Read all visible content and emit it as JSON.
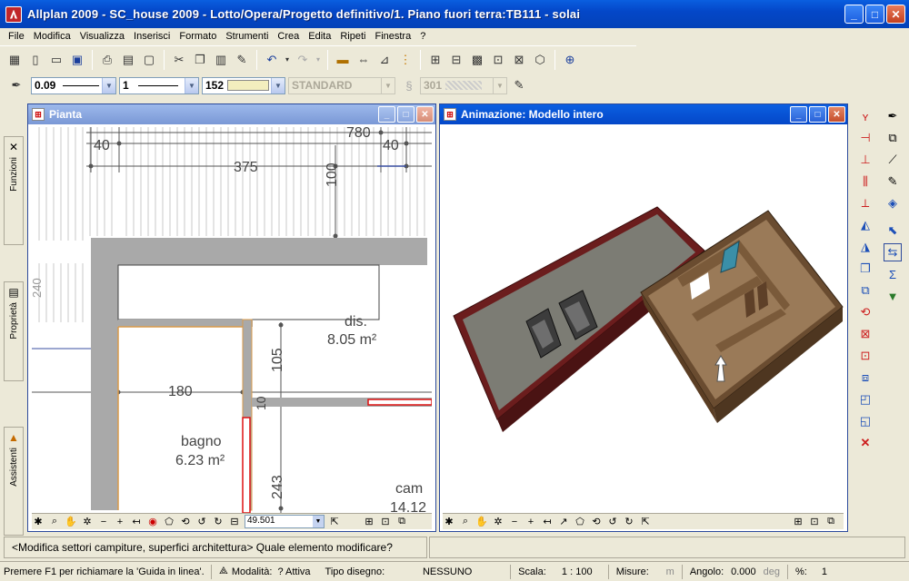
{
  "window": {
    "title": "Allplan 2009 - SC_house 2009 - Lotto/Opera/Progetto definitivo/1. Piano fuori terra:TB111 - solai",
    "min": "_",
    "max": "□",
    "close": "✕"
  },
  "menu": [
    "File",
    "Modifica",
    "Visualizza",
    "Inserisci",
    "Formato",
    "Strumenti",
    "Crea",
    "Edita",
    "Ripeti",
    "Finestra",
    "?"
  ],
  "format_bar": {
    "pen": "0.09",
    "line": "1",
    "color_index": "152",
    "layer": "STANDARD",
    "pattern": "301"
  },
  "left_tabs": [
    "Funzioni",
    "Proprietà",
    "Assistenti"
  ],
  "pianta": {
    "title": "Pianta",
    "dims": {
      "d40a": "40",
      "d780": "780",
      "d40b": "40",
      "d375": "375",
      "d100": "100",
      "d240": "240",
      "d105": "105",
      "d180": "180",
      "d10": "10",
      "d243": "243"
    },
    "rooms": {
      "dis_name": "dis.",
      "dis_area": "8.05 m²",
      "bagno_name": "bagno",
      "bagno_area": "6.23 m²",
      "cam_name": "cam",
      "cam_area": "14.12"
    },
    "zoom_value": "49.501"
  },
  "animazione": {
    "title": "Animazione: Modello intero"
  },
  "prompt": "<Modifica settori campiture, superfici architettura> Quale elemento modificare?",
  "status": {
    "help": "Premere F1 per richiamare la 'Guida in linea'.",
    "modalita_label": "Modalità:",
    "modalita_value": "? Attiva",
    "tipo_label": "Tipo disegno:",
    "tipo_value": "NESSUNO",
    "scala_label": "Scala:",
    "scala_value": "1 : 100",
    "misure_label": "Misure:",
    "misure_unit": "m",
    "angolo_label": "Angolo:",
    "angolo_value": "0.000",
    "angolo_unit": "deg",
    "percent_label": "%:",
    "percent_value": "1"
  }
}
